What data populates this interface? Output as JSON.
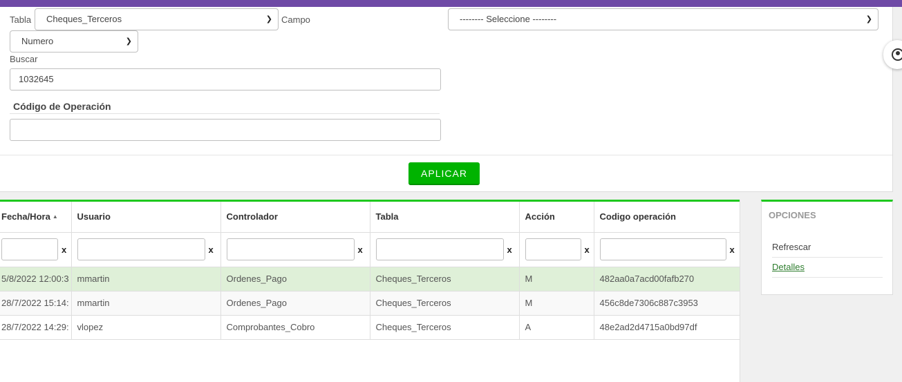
{
  "filters": {
    "tabla_label": "Tabla",
    "tabla_value": "Cheques_Terceros",
    "campo_label": "Campo",
    "campo_value": "-------- Seleccione --------",
    "numero_value": "Numero",
    "buscar_label": "Buscar",
    "buscar_value": "1032645",
    "codigo_title": "Código de Operación",
    "codigo_value": "",
    "apply_label": "APLICAR"
  },
  "grid": {
    "columns": [
      "Fecha/Hora",
      "Usuario",
      "Controlador",
      "Tabla",
      "Acción",
      "Codigo operación"
    ],
    "filter_clear": "x",
    "rows": [
      [
        "5/8/2022 12:00:3",
        "mmartin",
        "Ordenes_Pago",
        "Cheques_Terceros",
        "M",
        "482aa0a7acd00fafb270"
      ],
      [
        "28/7/2022 15:14:",
        "mmartin",
        "Ordenes_Pago",
        "Cheques_Terceros",
        "M",
        "456c8de7306c887c3953"
      ],
      [
        "28/7/2022 14:29:",
        "vlopez",
        "Comprobantes_Cobro",
        "Cheques_Terceros",
        "A",
        "48e2ad2d4715a0bd97df"
      ]
    ]
  },
  "options": {
    "title": "OPCIONES",
    "refresh": "Refrescar",
    "details": "Detalles"
  },
  "icons": {
    "user": "user-circle-icon",
    "chevron": "chevron-down-icon",
    "sort": "sort-desc-icon"
  },
  "colors": {
    "topbar": "#6f4aa6",
    "accent": "#1ec81e",
    "button": "#00b300",
    "selected_row": "#dff0d8"
  }
}
